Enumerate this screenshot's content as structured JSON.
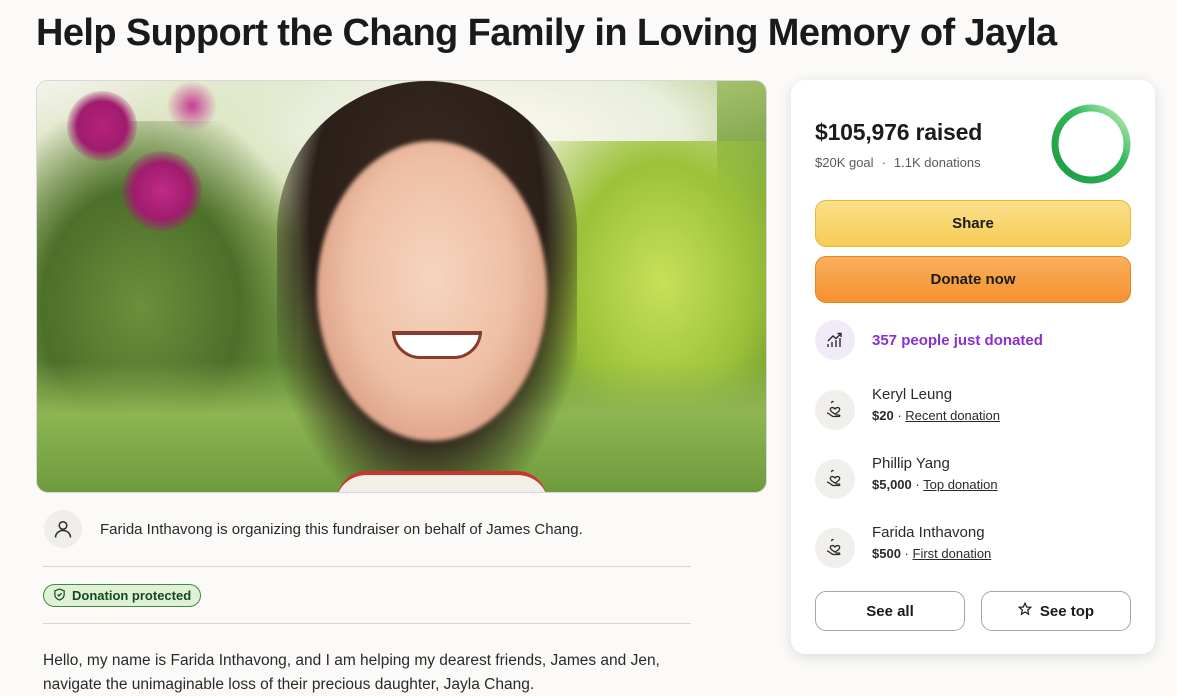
{
  "page": {
    "title": "Help Support the Chang Family in Loving Memory of Jayla"
  },
  "organizer": {
    "icon": "user-icon",
    "text": "Farida Inthavong is organizing this fundraiser on behalf of James Chang."
  },
  "badge": {
    "icon": "shield-icon",
    "label": "Donation protected",
    "color": "#3e8a3e"
  },
  "story": {
    "line1": "Hello, my name is Farida Inthavong, and I am helping my dearest friends, James and Jen,",
    "line2": "navigate the unimaginable loss of their precious daughter, Jayla Chang."
  },
  "progress": {
    "raised": "$105,976 raised",
    "goal": "$20K goal",
    "separator": "·",
    "donations": "1.1K donations",
    "fraction": 1.0,
    "ring_color": "#1fa84a"
  },
  "buttons": {
    "share": "Share",
    "donate": "Donate now",
    "see_all": "See all",
    "see_top": "See top",
    "share_color": "#f6cc55",
    "donate_color": "#f5912f"
  },
  "trend": {
    "icon": "trending-up-icon",
    "text": "357 people just donated",
    "color": "#8b2fd0"
  },
  "donations": [
    {
      "name": "Keryl Leung",
      "amount": "$20",
      "sep": "·",
      "type": "Recent donation",
      "icon": "heart-hand-icon"
    },
    {
      "name": "Phillip Yang",
      "amount": "$5,000",
      "sep": "·",
      "type": "Top donation",
      "icon": "heart-hand-icon"
    },
    {
      "name": "Farida Inthavong",
      "amount": "$500",
      "sep": "·",
      "type": "First donation",
      "icon": "heart-hand-icon"
    }
  ]
}
